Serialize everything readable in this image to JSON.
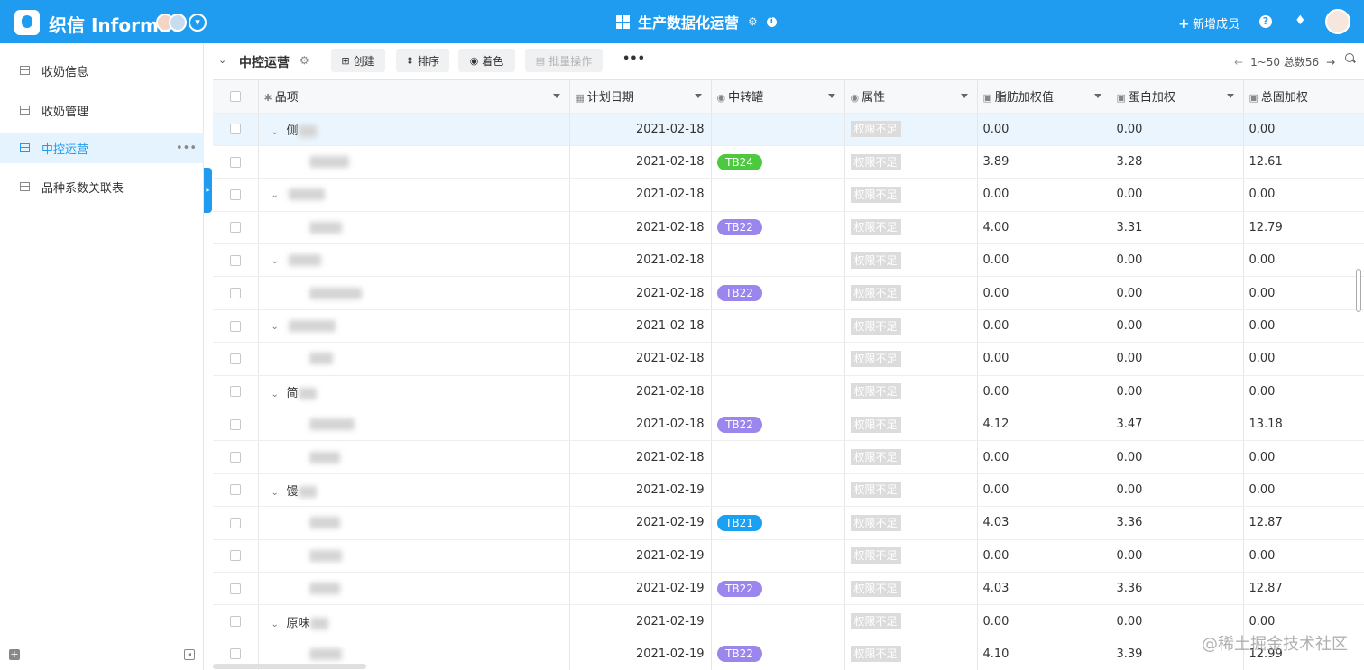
{
  "header": {
    "brand": "织信 Informat",
    "app_title": "生产数据化运营",
    "new_member": "新增成员",
    "help": "?",
    "bell": "🔔",
    "avatar_arrow": "▾"
  },
  "sidebar": {
    "items": [
      {
        "label": "收奶信息"
      },
      {
        "label": "收奶管理"
      },
      {
        "label": "中控运营"
      },
      {
        "label": "品种系数关联表"
      }
    ],
    "more": "•••"
  },
  "toolbar": {
    "view_title": "中控运营",
    "create": "创建",
    "sort": "排序",
    "color": "着色",
    "batch": "批量操作",
    "more": "•••",
    "pager": "1~50 总数56"
  },
  "table": {
    "columns": {
      "item": "品项",
      "date": "计划日期",
      "tank": "中转罐",
      "attr": "属性",
      "fat": "脂肪加权值",
      "protein": "蛋白加权",
      "solids": "总固加权"
    },
    "rows": [
      {
        "name": "侧",
        "group": true,
        "date": "2021-02-18",
        "tank": "",
        "attr": "权限不足",
        "fat": "0.00",
        "protein": "0.00",
        "solids": "0.00"
      },
      {
        "name": "",
        "group": false,
        "date": "2021-02-18",
        "tank": "TB24",
        "attr": "权限不足",
        "fat": "3.89",
        "protein": "3.28",
        "solids": "12.61"
      },
      {
        "name": "",
        "group": true,
        "date": "2021-02-18",
        "tank": "",
        "attr": "权限不足",
        "fat": "0.00",
        "protein": "0.00",
        "solids": "0.00"
      },
      {
        "name": "",
        "group": false,
        "date": "2021-02-18",
        "tank": "TB22",
        "attr": "权限不足",
        "fat": "4.00",
        "protein": "3.31",
        "solids": "12.79"
      },
      {
        "name": "",
        "group": true,
        "date": "2021-02-18",
        "tank": "",
        "attr": "权限不足",
        "fat": "0.00",
        "protein": "0.00",
        "solids": "0.00"
      },
      {
        "name": "",
        "group": false,
        "date": "2021-02-18",
        "tank": "TB22",
        "attr": "权限不足",
        "fat": "0.00",
        "protein": "0.00",
        "solids": "0.00"
      },
      {
        "name": "",
        "group": true,
        "date": "2021-02-18",
        "tank": "",
        "attr": "权限不足",
        "fat": "0.00",
        "protein": "0.00",
        "solids": "0.00"
      },
      {
        "name": "",
        "group": false,
        "date": "2021-02-18",
        "tank": "",
        "attr": "权限不足",
        "fat": "0.00",
        "protein": "0.00",
        "solids": "0.00"
      },
      {
        "name": "简",
        "group": true,
        "date": "2021-02-18",
        "tank": "",
        "attr": "权限不足",
        "fat": "0.00",
        "protein": "0.00",
        "solids": "0.00"
      },
      {
        "name": "",
        "group": false,
        "date": "2021-02-18",
        "tank": "TB22",
        "attr": "权限不足",
        "fat": "4.12",
        "protein": "3.47",
        "solids": "13.18"
      },
      {
        "name": "",
        "group": false,
        "date": "2021-02-18",
        "tank": "",
        "attr": "权限不足",
        "fat": "0.00",
        "protein": "0.00",
        "solids": "0.00"
      },
      {
        "name": "馒",
        "group": true,
        "date": "2021-02-19",
        "tank": "",
        "attr": "权限不足",
        "fat": "0.00",
        "protein": "0.00",
        "solids": "0.00"
      },
      {
        "name": "",
        "group": false,
        "date": "2021-02-19",
        "tank": "TB21",
        "attr": "权限不足",
        "fat": "4.03",
        "protein": "3.36",
        "solids": "12.87"
      },
      {
        "name": "",
        "group": false,
        "date": "2021-02-19",
        "tank": "",
        "attr": "权限不足",
        "fat": "0.00",
        "protein": "0.00",
        "solids": "0.00"
      },
      {
        "name": "",
        "group": false,
        "date": "2021-02-19",
        "tank": "TB22",
        "attr": "权限不足",
        "fat": "4.03",
        "protein": "3.36",
        "solids": "12.87"
      },
      {
        "name": "原味",
        "group": true,
        "date": "2021-02-19",
        "tank": "",
        "attr": "权限不足",
        "fat": "0.00",
        "protein": "0.00",
        "solids": "0.00"
      },
      {
        "name": "",
        "group": false,
        "date": "2021-02-19",
        "tank": "TB22",
        "attr": "权限不足",
        "fat": "4.10",
        "protein": "3.39",
        "solids": "12.99"
      }
    ]
  },
  "tank_colors": {
    "TB24": "#4cc93f",
    "TB22": "#9b86ee",
    "TB21": "#1aa1f2"
  },
  "watermark": "@稀土掘金技术社区"
}
